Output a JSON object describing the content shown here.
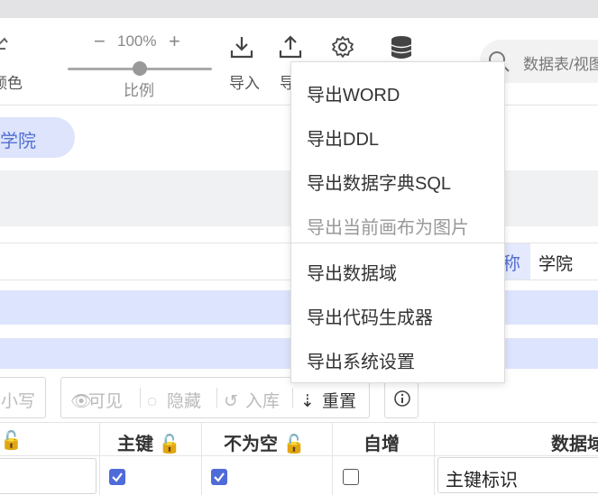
{
  "toolbar": {
    "color_label": "颜色",
    "zoom_value": "100%",
    "zoom_minus": "−",
    "zoom_plus": "+",
    "zoom_level": 0.5,
    "scale_label": "比例",
    "import_label": "导入",
    "export_label": "导"
  },
  "search": {
    "placeholder": "数据表/视图"
  },
  "tabs": [
    {
      "label": "学院"
    }
  ],
  "entity": {
    "name_label": "称",
    "name_value": "学院"
  },
  "buttons": {
    "lowercase": "小写",
    "visible": "可见",
    "hidden": "隐藏",
    "store": "入库",
    "reset": "重置"
  },
  "table": {
    "headers": [
      "主键",
      "不为空",
      "自增",
      "数据域"
    ],
    "first_row": {
      "pk": true,
      "not_null": true,
      "auto_inc": false,
      "domain": "主键标识"
    }
  },
  "export_menu": {
    "items": [
      {
        "label": "导出WORD",
        "enabled": true
      },
      {
        "label": "导出DDL",
        "enabled": true
      },
      {
        "label": "导出数据字典SQL",
        "enabled": true
      },
      {
        "label": "导出当前画布为图片",
        "enabled": false
      },
      {
        "label": "导出数据域",
        "enabled": true
      },
      {
        "label": "导出代码生成器",
        "enabled": true
      },
      {
        "label": "导出系统设置",
        "enabled": true
      }
    ]
  },
  "colors": {
    "accent": "#4f6bd8",
    "pill_bg": "#dde4fb",
    "band_blue": "#dde4fd"
  }
}
